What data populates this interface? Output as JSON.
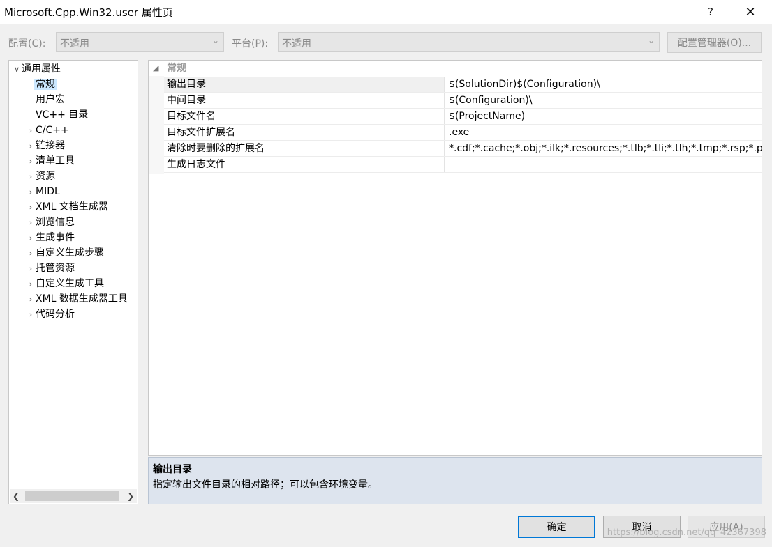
{
  "window": {
    "title": "Microsoft.Cpp.Win32.user 属性页",
    "help_glyph": "?",
    "close_glyph": "✕"
  },
  "config_bar": {
    "config_label": "配置(C):",
    "config_value": "不适用",
    "platform_label": "平台(P):",
    "platform_value": "不适用",
    "manager_button": "配置管理器(O)..."
  },
  "tree": {
    "items": [
      {
        "label": "通用属性",
        "level": 0,
        "expander": "open"
      },
      {
        "label": "常规",
        "level": 1,
        "expander": "none",
        "selected": true
      },
      {
        "label": "用户宏",
        "level": 1,
        "expander": "none"
      },
      {
        "label": "VC++ 目录",
        "level": 1,
        "expander": "none"
      },
      {
        "label": "C/C++",
        "level": 1,
        "expander": "closed"
      },
      {
        "label": "链接器",
        "level": 1,
        "expander": "closed"
      },
      {
        "label": "清单工具",
        "level": 1,
        "expander": "closed"
      },
      {
        "label": "资源",
        "level": 1,
        "expander": "closed"
      },
      {
        "label": "MIDL",
        "level": 1,
        "expander": "closed"
      },
      {
        "label": "XML 文档生成器",
        "level": 1,
        "expander": "closed"
      },
      {
        "label": "浏览信息",
        "level": 1,
        "expander": "closed"
      },
      {
        "label": "生成事件",
        "level": 1,
        "expander": "closed"
      },
      {
        "label": "自定义生成步骤",
        "level": 1,
        "expander": "closed"
      },
      {
        "label": "托管资源",
        "level": 1,
        "expander": "closed"
      },
      {
        "label": "自定义生成工具",
        "level": 1,
        "expander": "closed"
      },
      {
        "label": "XML 数据生成器工具",
        "level": 1,
        "expander": "closed"
      },
      {
        "label": "代码分析",
        "level": 1,
        "expander": "closed"
      }
    ]
  },
  "grid": {
    "category": "常规",
    "properties": [
      {
        "name": "输出目录",
        "value": "$(SolutionDir)$(Configuration)\\",
        "selected": true
      },
      {
        "name": "中间目录",
        "value": "$(Configuration)\\"
      },
      {
        "name": "目标文件名",
        "value": "$(ProjectName)"
      },
      {
        "name": "目标文件扩展名",
        "value": ".exe"
      },
      {
        "name": "清除时要删除的扩展名",
        "value": "*.cdf;*.cache;*.obj;*.ilk;*.resources;*.tlb;*.tli;*.tlh;*.tmp;*.rsp;*.p"
      },
      {
        "name": "生成日志文件",
        "value": ""
      }
    ]
  },
  "description": {
    "title": "输出目录",
    "text": "指定输出文件目录的相对路径；可以包含环境变量。"
  },
  "buttons": {
    "ok": "确定",
    "cancel": "取消",
    "apply": "应用(A)"
  },
  "watermark": "https://blog.csdn.net/qq_42367398"
}
